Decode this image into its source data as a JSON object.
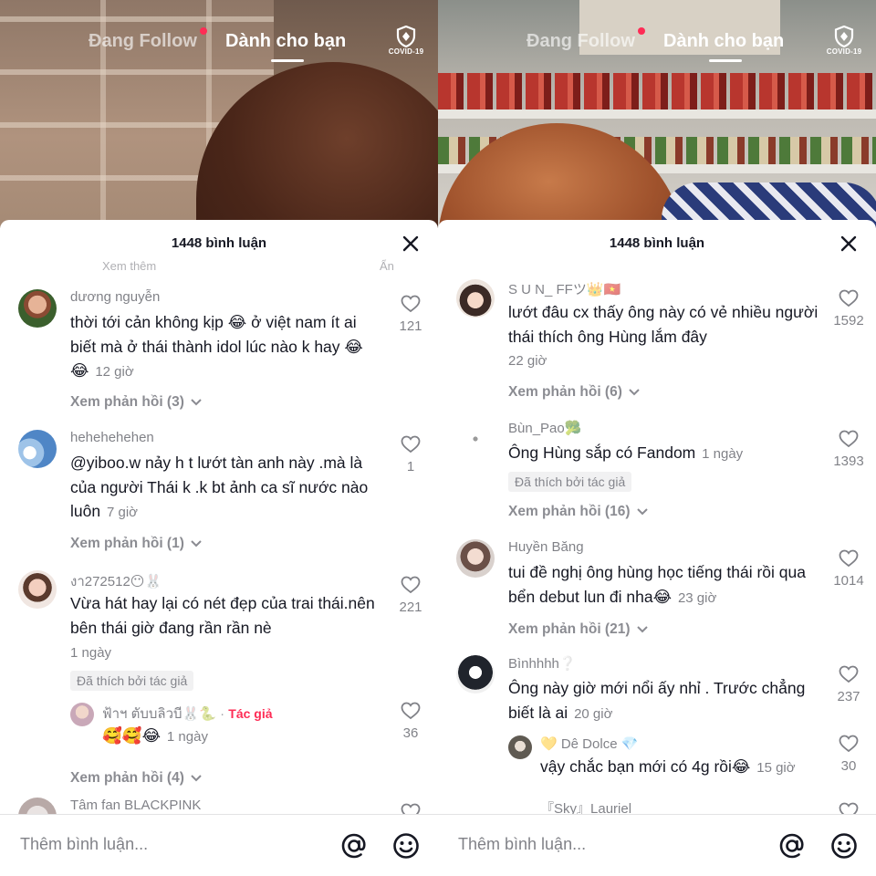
{
  "nav": {
    "following": "Đang Follow",
    "for_you": "Dành cho bạn",
    "covid_label": "COVID-19"
  },
  "left": {
    "comment_count_title": "1448 bình luận",
    "faded_prev_left": "Xem thêm",
    "faded_prev_right": "Ẩn",
    "comments": [
      {
        "username": "dương nguyễn",
        "text": "thời tới cản không kịp 😂 ở việt nam ít ai biết mà ở thái thành idol lúc nào k hay 😂😂",
        "time": "12 giờ",
        "likes": "121",
        "view_replies": "Xem phản hồi (3)"
      },
      {
        "username": "hehehehehen",
        "text": "@yiboo.w nảy h t lướt tàn anh này .mà là của người Thái k .k bt ảnh ca sĩ nước nào luôn",
        "time": "7 giờ",
        "likes": "1",
        "view_replies": "Xem phản hồi (1)"
      },
      {
        "username": "งา272512😶🐰",
        "text": "Vừa hát hay lại có nét đẹp của trai thái.nên bên thái giờ đang rần rần nè",
        "time": "1 ngày",
        "likes": "221",
        "liked_by_author": "Đã thích bởi tác giả",
        "reply": {
          "username": "ฟ้าฯ ตับบลิวบี🐰🐍",
          "author_tag": "Tác giả",
          "text": "🥰🥰😂",
          "time": "1 ngày",
          "likes": "36"
        },
        "view_replies": "Xem phản hồi (4)"
      },
      {
        "username": "Tâm fan BLACKPINK"
      }
    ],
    "input_placeholder": "Thêm bình luận..."
  },
  "right": {
    "comment_count_title": "1448 bình luận",
    "comments": [
      {
        "username": "S U N_ FFツ👑🇻🇳",
        "text": "lướt đâu cx thấy ông này có vẻ nhiều người thái thích ông Hùng lắm đây",
        "time": "22 giờ",
        "likes": "1592",
        "view_replies": "Xem phản hồi (6)"
      },
      {
        "username": "Bùn_Pao🥦",
        "text": "Ông Hùng sắp có Fandom",
        "time": "1 ngày",
        "likes": "1393",
        "liked_by_author": "Đã thích bởi tác giả",
        "view_replies": "Xem phản hồi (16)"
      },
      {
        "username": "Huyền Băng",
        "text": "tui đề nghị ông hùng học tiếng thái rồi qua bển debut lun đi nha😂",
        "time": "23 giờ",
        "likes": "1014",
        "view_replies": "Xem phản hồi (21)"
      },
      {
        "username": "Bìnhhhh❔",
        "text": "Ông này giờ mới nổi ấy nhỉ . Trước chẳng biết là ai",
        "time": "20 giờ",
        "likes": "237",
        "reply": {
          "username": "💛 Dê Dolce 💎",
          "text": "vậy chắc bạn mới có 4g rồi😂",
          "time": "15 giờ",
          "likes": "30"
        }
      },
      {
        "username": "『Sky』Lauriel"
      }
    ],
    "input_placeholder": "Thêm bình luận..."
  },
  "colors": {
    "accent": "#fe2c55",
    "text_primary": "#161823",
    "text_secondary": "#8a8b91"
  },
  "icons": [
    "shield-icon",
    "close-icon",
    "heart-icon",
    "chevron-down-icon",
    "at-icon",
    "emoji-icon"
  ]
}
